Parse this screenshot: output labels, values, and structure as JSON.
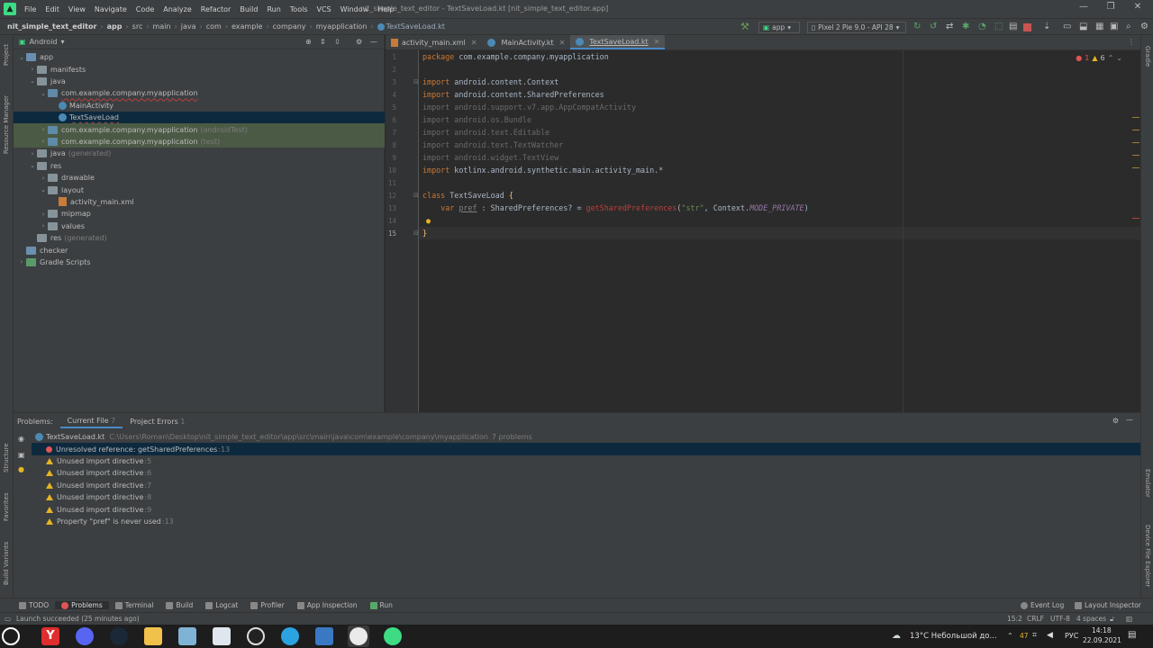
{
  "titlebar": {
    "menus": [
      "File",
      "Edit",
      "View",
      "Navigate",
      "Code",
      "Analyze",
      "Refactor",
      "Build",
      "Run",
      "Tools",
      "VCS",
      "Window",
      "Help"
    ],
    "window_title": "nit_simple_text_editor - TextSaveLoad.kt [nit_simple_text_editor.app]"
  },
  "navbar": {
    "crumbs": [
      "nit_simple_text_editor",
      "app",
      "src",
      "main",
      "java",
      "com",
      "example",
      "company",
      "myapplication",
      "TextSaveLoad.kt"
    ],
    "run_config": "app",
    "device": "Pixel 2 Pie 9.0 - API 28"
  },
  "left_strip": {
    "project": "Project",
    "resource_manager": "Resource Manager",
    "structure": "Structure",
    "favorites": "Favorites",
    "build_variants": "Build Variants"
  },
  "right_strip": {
    "gradle": "Gradle",
    "emulator": "Emulator",
    "device_file_explorer": "Device File Explorer"
  },
  "project": {
    "view_mode": "Android",
    "tree": [
      {
        "label": "app",
        "dim": ""
      },
      {
        "label": "manifests",
        "dim": ""
      },
      {
        "label": "java",
        "dim": ""
      },
      {
        "label": "com.example.company.myapplication",
        "dim": ""
      },
      {
        "label": "MainActivity",
        "dim": ""
      },
      {
        "label": "TextSaveLoad",
        "dim": ""
      },
      {
        "label": "com.example.company.myapplication",
        "dim": "(androidTest)"
      },
      {
        "label": "com.example.company.myapplication",
        "dim": "(test)"
      },
      {
        "label": "java",
        "dim": "(generated)"
      },
      {
        "label": "res",
        "dim": ""
      },
      {
        "label": "drawable",
        "dim": ""
      },
      {
        "label": "layout",
        "dim": ""
      },
      {
        "label": "activity_main.xml",
        "dim": ""
      },
      {
        "label": "mipmap",
        "dim": ""
      },
      {
        "label": "values",
        "dim": ""
      },
      {
        "label": "res",
        "dim": "(generated)"
      },
      {
        "label": "checker",
        "dim": ""
      },
      {
        "label": "Gradle Scripts",
        "dim": ""
      }
    ]
  },
  "tabs": [
    "activity_main.xml",
    "MainActivity.kt",
    "TextSaveLoad.kt"
  ],
  "editor": {
    "line_numbers": [
      "1",
      "2",
      "3",
      "4",
      "5",
      "6",
      "7",
      "8",
      "9",
      "10",
      "11",
      "12",
      "13",
      "14",
      "15"
    ],
    "inspections": {
      "errors": "1",
      "warnings": "6"
    },
    "lines": {
      "l1_kw": "package",
      "l1_rest": " com.example.company.myapplication",
      "l3_kw": "import",
      "l3_rest": " android.content.Context",
      "l4_kw": "import",
      "l4_rest": " android.content.SharedPreferences",
      "l5": "import android.support.v7.app.AppCompatActivity",
      "l6": "import android.os.Bundle",
      "l7": "import android.text.Editable",
      "l8": "import android.text.TextWatcher",
      "l9": "import android.widget.TextView",
      "l10_kw": "import",
      "l10_rest": " kotlinx.android.synthetic.main.activity_main.*",
      "l12_kw": "class",
      "l12_name": " TextSaveLoad ",
      "l12_brace": "{",
      "l13_kw": "    var ",
      "l13_var": "pref",
      "l13_mid": " : SharedPreferences? = ",
      "l13_fn": "getSharedPreferences",
      "l13_p1": "(",
      "l13_str": "\"str\"",
      "l13_p2": ", Context.",
      "l13_const": "MODE_PRIVATE",
      "l13_p3": ")",
      "l15": "}"
    }
  },
  "problems": {
    "title": "Problems:",
    "tabs": [
      {
        "label": "Current File",
        "count": "7"
      },
      {
        "label": "Project Errors",
        "count": "1"
      }
    ],
    "file": "TextSaveLoad.kt",
    "path": "C:\\Users\\Roman\\Desktop\\nit_simple_text_editor\\app\\src\\main\\java\\com\\example\\company\\myapplication",
    "count": "7 problems",
    "items": [
      {
        "text": "Unresolved reference: getSharedPreferences",
        "line": ":13",
        "type": "error"
      },
      {
        "text": "Unused import directive",
        "line": ":5",
        "type": "warning"
      },
      {
        "text": "Unused import directive",
        "line": ":6",
        "type": "warning"
      },
      {
        "text": "Unused import directive",
        "line": ":7",
        "type": "warning"
      },
      {
        "text": "Unused import directive",
        "line": ":8",
        "type": "warning"
      },
      {
        "text": "Unused import directive",
        "line": ":9",
        "type": "warning"
      },
      {
        "text": "Property \"pref\" is never used",
        "line": ":13",
        "type": "warning"
      }
    ]
  },
  "bottom_tools": [
    "TODO",
    "Problems",
    "Terminal",
    "Build",
    "Logcat",
    "Profiler",
    "App Inspection",
    "Run"
  ],
  "bottom_right_tools": [
    "Event Log",
    "Layout Inspector"
  ],
  "status": {
    "message": "Launch succeeded (25 minutes ago)",
    "position": "15:2",
    "line_sep": "CRLF",
    "encoding": "UTF-8",
    "indent": "4 spaces"
  },
  "taskbar": {
    "weather": "13°C  Небольшой до...",
    "tray_count": "47",
    "lang": "РУС",
    "time": "14:18",
    "date": "22.09.2021"
  },
  "colors": {
    "accent": "#4a88c7",
    "error": "#e05555",
    "warning": "#e6b422",
    "android_green": "#3ddc84"
  }
}
